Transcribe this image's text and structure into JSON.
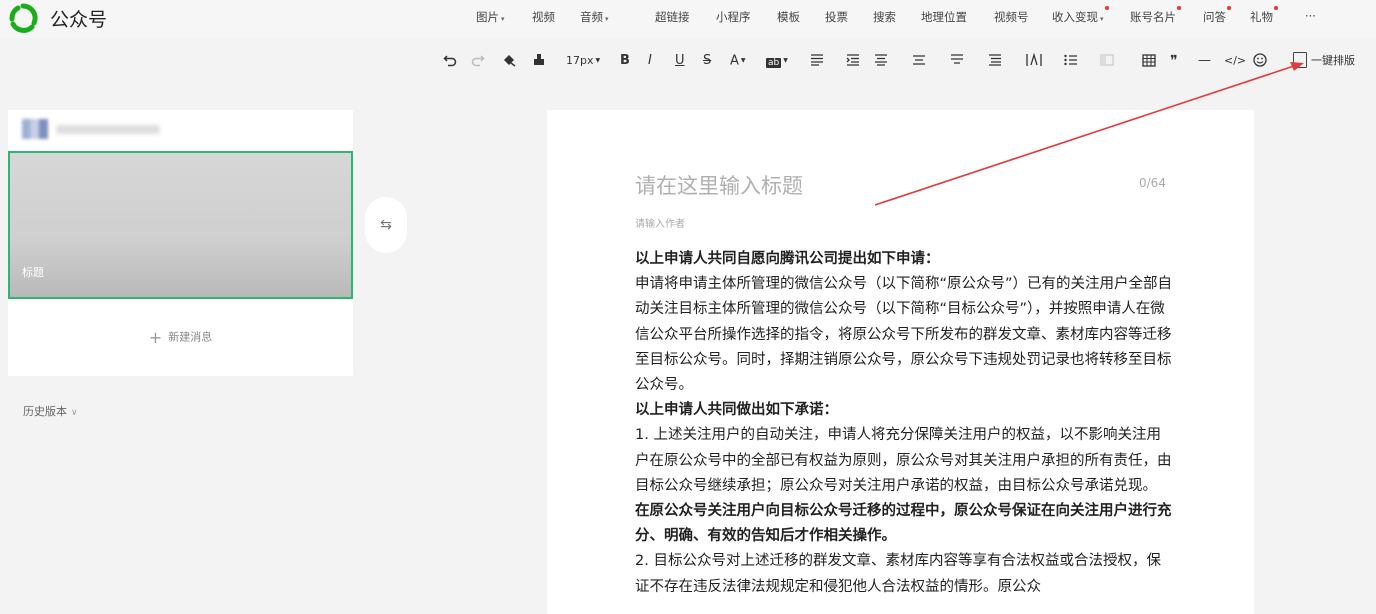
{
  "app": {
    "title": "公众号"
  },
  "insert_menu": [
    {
      "label": "图片",
      "caret": true,
      "dot": false
    },
    {
      "label": "视频",
      "caret": false,
      "dot": false
    },
    {
      "label": "音频",
      "caret": true,
      "dot": false
    },
    {
      "label": "超链接",
      "caret": false,
      "dot": false
    },
    {
      "label": "小程序",
      "caret": false,
      "dot": false
    },
    {
      "label": "模板",
      "caret": false,
      "dot": false
    },
    {
      "label": "投票",
      "caret": false,
      "dot": false
    },
    {
      "label": "搜索",
      "caret": false,
      "dot": false
    },
    {
      "label": "地理位置",
      "caret": false,
      "dot": false
    },
    {
      "label": "视频号",
      "caret": false,
      "dot": false
    },
    {
      "label": "收入变现",
      "caret": true,
      "dot": true
    },
    {
      "label": "账号名片",
      "caret": false,
      "dot": true
    },
    {
      "label": "问答",
      "caret": false,
      "dot": true
    },
    {
      "label": "礼物",
      "caret": false,
      "dot": true
    },
    {
      "label": "···",
      "caret": false,
      "dot": false
    }
  ],
  "toolbar": {
    "font_size": "17px",
    "bold": "B",
    "italic": "I",
    "underline": "U",
    "strike": "S",
    "font_color": "A",
    "bg_color": "ab",
    "quote": "❞",
    "divider": "—",
    "code": "</>",
    "onekey_label": "一键排版"
  },
  "sidebar": {
    "article_label": "标题",
    "new_message": "新建消息",
    "history": "历史版本"
  },
  "editor": {
    "title_placeholder": "请在这里输入标题",
    "title_counter": "0/64",
    "author_placeholder": "请输入作者",
    "paragraphs": [
      {
        "text": "以上申请人共同自愿向腾讯公司提出如下申请：",
        "bold": true
      },
      {
        "text": "申请将申请主体所管理的微信公众号（以下简称“原公众号”）已有的关注用户全部自动关注目标主体所管理的微信公众号（以下简称“目标公众号”），并按照申请人在微信公众平台所操作选择的指令，将原公众号下所发布的群发文章、素材库内容等迁移至目标公众号。同时，择期注销原公众号，原公众号下违规处罚记录也将转移至目标公众号。",
        "bold": false
      },
      {
        "text": "以上申请人共同做出如下承诺：",
        "bold": true
      },
      {
        "text": "1. 上述关注用户的自动关注，申请人将充分保障关注用户的权益，以不影响关注用户在原公众号中的全部已有权益为原则，原公众号对其关注用户承担的所有责任，由目标公众号继续承担；原公众号对关注用户承诺的权益，由目标公众号承诺兑现。",
        "bold": false
      },
      {
        "text": "在原公众号关注用户向目标公众号迁移的过程中，原公众号保证在向关注用户进行充分、明确、有效的告知后才作相关操作。",
        "bold": true
      },
      {
        "text": "2. 目标公众号对上述迁移的群发文章、素材库内容等享有合法权益或合法授权，保证不存在违反法律法规规定和侵犯他人合法权益的情形。原公众",
        "bold": false
      }
    ]
  },
  "colors": {
    "accent": "#2bb673",
    "annotation_arrow": "#e23b3b",
    "notify_dot": "#e33333"
  }
}
